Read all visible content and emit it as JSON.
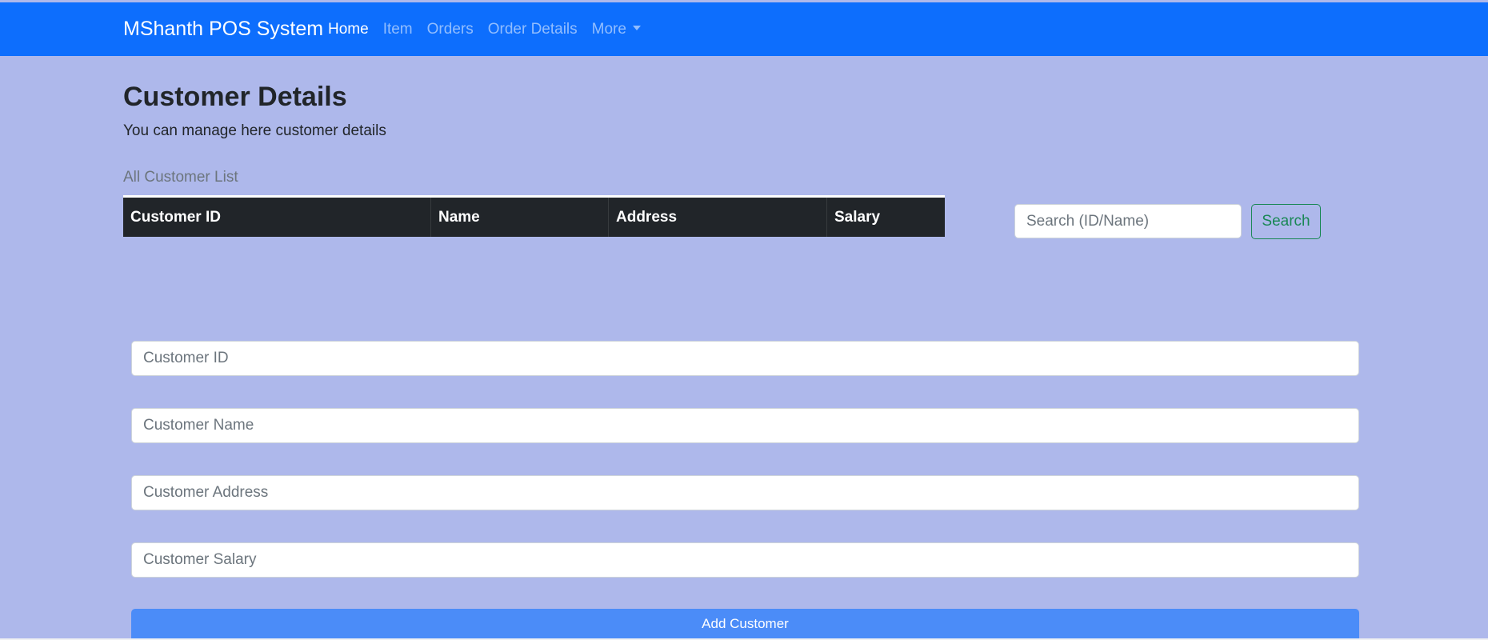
{
  "navbar": {
    "brand": "MShanth POS System",
    "links": [
      {
        "label": "Home",
        "active": true
      },
      {
        "label": "Item",
        "active": false
      },
      {
        "label": "Orders",
        "active": false
      },
      {
        "label": "Order Details",
        "active": false
      },
      {
        "label": "More",
        "active": false,
        "dropdown": true
      }
    ],
    "background": "#0d6efd"
  },
  "header": {
    "title": "Customer Details",
    "subtitle": "You can manage here customer details"
  },
  "table": {
    "caption": "All Customer List",
    "columns": [
      "Customer ID",
      "Name",
      "Address",
      "Salary"
    ],
    "rows": []
  },
  "search": {
    "placeholder": "Search (ID/Name)",
    "value": "",
    "button_label": "Search"
  },
  "form": {
    "customer_id_placeholder": "Customer ID",
    "customer_name_placeholder": "Customer Name",
    "customer_address_placeholder": "Customer Address",
    "customer_salary_placeholder": "Customer Salary",
    "submit_label": "Add Customer"
  },
  "colors": {
    "page_background": "#aeb8eb",
    "primary": "#0d6efd",
    "success": "#198754",
    "table_dark": "#212529"
  }
}
